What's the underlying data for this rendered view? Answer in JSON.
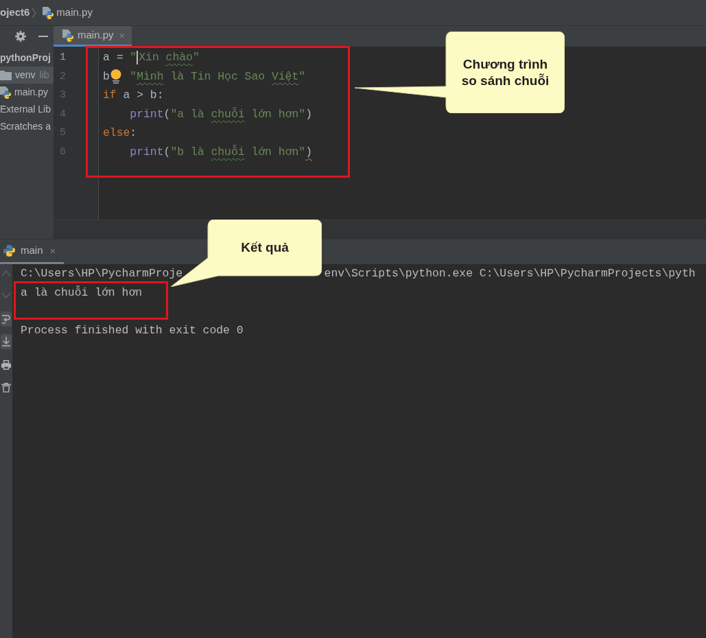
{
  "breadcrumb": [
    {
      "kind": "project",
      "label": "oject6"
    },
    {
      "kind": "file",
      "label": "main.py"
    }
  ],
  "editor_tabs": [
    {
      "label": "main.py",
      "close": "×",
      "selected": true
    }
  ],
  "project_tree": [
    {
      "kind": "project",
      "label": "pythonProj",
      "selected": false,
      "children": [
        {
          "kind": "folder",
          "label": "venv",
          "note": "lib",
          "selected": true
        },
        {
          "kind": "python_file",
          "label": "main.py",
          "selected": false
        }
      ]
    },
    {
      "kind": "libraries",
      "label": "External Lib",
      "selected": false
    },
    {
      "kind": "scratches",
      "label": "Scratches a",
      "selected": false
    }
  ],
  "code_lines": [
    {
      "number": "1",
      "current": true,
      "indented": false,
      "tokens": [
        {
          "kind": "plain",
          "text": "a = "
        },
        {
          "kind": "string",
          "text": "\""
        },
        {
          "kind": "caret"
        },
        {
          "kind": "string",
          "text": "Xin "
        },
        {
          "kind": "typo",
          "text": "chào"
        },
        {
          "kind": "string",
          "text": "\""
        }
      ]
    },
    {
      "number": "2",
      "current": false,
      "indented": false,
      "tokens": [
        {
          "kind": "plain",
          "text": "b"
        },
        {
          "kind": "bulb"
        },
        {
          "kind": "string",
          "text": "\""
        },
        {
          "kind": "typo",
          "text": "Mình"
        },
        {
          "kind": "string",
          "text": " là Tin Học Sao "
        },
        {
          "kind": "typo",
          "text": "Việt"
        },
        {
          "kind": "string",
          "text": "\""
        }
      ]
    },
    {
      "number": "3",
      "current": false,
      "indented": false,
      "tokens": [
        {
          "kind": "keyword",
          "text": "if"
        },
        {
          "kind": "plain",
          "text": " a > b:"
        }
      ]
    },
    {
      "number": "4",
      "current": false,
      "indented": true,
      "tokens": [
        {
          "kind": "builtin",
          "text": "print"
        },
        {
          "kind": "plain",
          "text": "("
        },
        {
          "kind": "string",
          "text": "\"a là "
        },
        {
          "kind": "typo",
          "text": "chuỗi"
        },
        {
          "kind": "string",
          "text": " lớn hơn\""
        },
        {
          "kind": "plain",
          "text": ")"
        }
      ]
    },
    {
      "number": "5",
      "current": false,
      "indented": false,
      "tokens": [
        {
          "kind": "keyword",
          "text": "else"
        },
        {
          "kind": "plain",
          "text": ":"
        }
      ]
    },
    {
      "number": "6",
      "current": false,
      "indented": true,
      "tokens": [
        {
          "kind": "builtin",
          "text": "print"
        },
        {
          "kind": "plain",
          "text": "("
        },
        {
          "kind": "string",
          "text": "\"b là "
        },
        {
          "kind": "typo",
          "text": "chuỗi"
        },
        {
          "kind": "string",
          "text": " lớn hơn\""
        },
        {
          "kind": "warn",
          "text": ")"
        }
      ]
    }
  ],
  "run_tabs": [
    {
      "label": "main",
      "close": "×",
      "selected": true
    }
  ],
  "run_toolbar": [
    {
      "kind": "up",
      "on": false,
      "disabled": true
    },
    {
      "kind": "down",
      "on": false,
      "disabled": true
    },
    {
      "kind": "wrap",
      "on": true,
      "disabled": false
    },
    {
      "kind": "scroll_end",
      "on": true,
      "disabled": false
    },
    {
      "kind": "print",
      "on": false,
      "disabled": false
    },
    {
      "kind": "trash",
      "on": false,
      "disabled": false
    }
  ],
  "console_lines": [
    {
      "kind": "command",
      "segments": [
        "C:\\Users\\HP\\PycharmProje",
        "env\\Scripts\\python.exe C:\\Users\\HP\\PycharmProjects\\pyth"
      ]
    },
    {
      "kind": "text",
      "text": "a là chuỗi lớn hơn"
    },
    {
      "kind": "blank"
    },
    {
      "kind": "text",
      "text": "Process finished with exit code 0"
    }
  ],
  "callouts": [
    {
      "text": "Chương trình so sánh chuỗi"
    },
    {
      "text": "Kết quả"
    }
  ]
}
